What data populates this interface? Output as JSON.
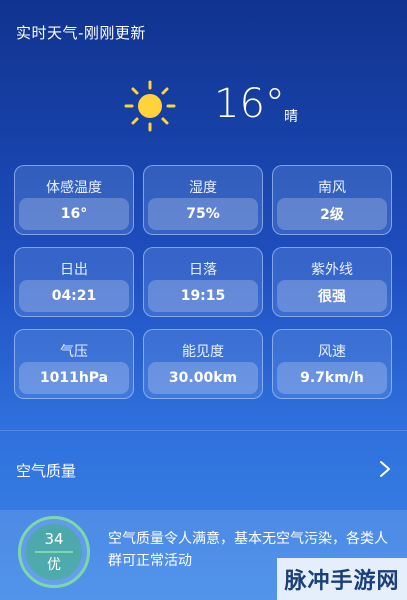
{
  "header": {
    "title": "实时天气-刚刚更新"
  },
  "current": {
    "icon": "sun-icon",
    "temperature": "16°",
    "condition": "晴"
  },
  "details": [
    {
      "label": "体感温度",
      "value": "16°"
    },
    {
      "label": "湿度",
      "value": "75%"
    },
    {
      "label": "南风",
      "value": "2级"
    },
    {
      "label": "日出",
      "value": "04:21"
    },
    {
      "label": "日落",
      "value": "19:15"
    },
    {
      "label": "紫外线",
      "value": "很强"
    },
    {
      "label": "气压",
      "value": "1011hPa"
    },
    {
      "label": "能见度",
      "value": "30.00km"
    },
    {
      "label": "风速",
      "value": "9.7km/h"
    }
  ],
  "air_quality": {
    "label": "空气质量",
    "aqi": "34",
    "level": "优",
    "description": "空气质量令人满意，基本无空气污染，各类人群可正常活动",
    "badge_color": "#7bd9a8"
  },
  "watermark": {
    "text": "脉冲手游网"
  },
  "colors": {
    "sun": "#ffd43b",
    "background_top": "#10338f",
    "background_bottom": "#3a86e8"
  }
}
